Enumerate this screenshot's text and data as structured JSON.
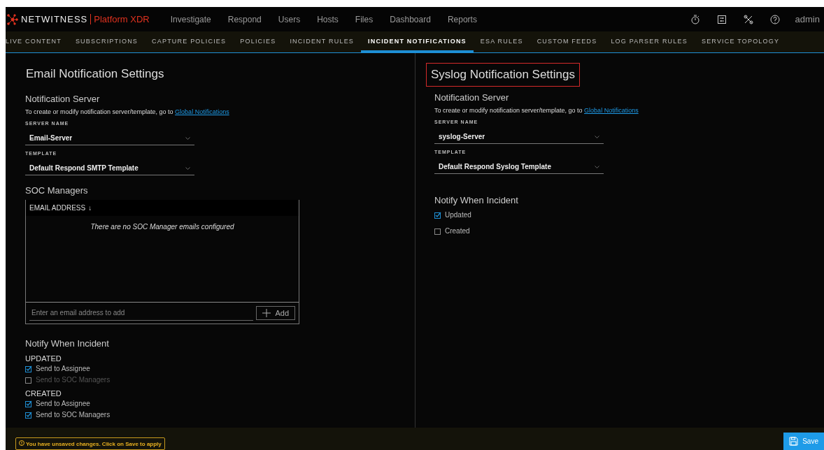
{
  "brand": {
    "name": "NETWITNESS",
    "product": "Platform XDR"
  },
  "nav": [
    "Investigate",
    "Respond",
    "Users",
    "Hosts",
    "Files",
    "Dashboard",
    "Reports"
  ],
  "user": "admin",
  "tabs": [
    {
      "label": "LIVE CONTENT",
      "selected": false
    },
    {
      "label": "SUBSCRIPTIONS",
      "selected": false
    },
    {
      "label": "CAPTURE POLICIES",
      "selected": false
    },
    {
      "label": "POLICIES",
      "selected": false
    },
    {
      "label": "INCIDENT RULES",
      "selected": false
    },
    {
      "label": "INCIDENT NOTIFICATIONS",
      "selected": true
    },
    {
      "label": "ESA RULES",
      "selected": false
    },
    {
      "label": "CUSTOM FEEDS",
      "selected": false
    },
    {
      "label": "LOG PARSER RULES",
      "selected": false
    },
    {
      "label": "SERVICE TOPOLOGY",
      "selected": false
    }
  ],
  "email": {
    "title": "Email Notification Settings",
    "server_heading": "Notification Server",
    "hint": "To create or modify notification server/template, go to ",
    "link": "Global Notifications",
    "server_label": "SERVER NAME",
    "server": "Email-Server",
    "template_label": "TEMPLATE",
    "template": "Default Respond SMTP Template",
    "soc_heading": "SOC Managers",
    "column": "EMAIL ADDRESS",
    "sort_icon": "↓",
    "empty": "There are no SOC Manager emails configured",
    "placeholder": "Enter an email address to add",
    "add": "Add",
    "notify_heading": "Notify When Incident",
    "groups": [
      {
        "label": "UPDATED",
        "options": [
          {
            "label": "Send to Assignee",
            "checked": true,
            "disabled": false
          },
          {
            "label": "Send to SOC Managers",
            "checked": false,
            "disabled": true
          }
        ]
      },
      {
        "label": "CREATED",
        "options": [
          {
            "label": "Send to Assignee",
            "checked": true,
            "disabled": false
          },
          {
            "label": "Send to SOC Managers",
            "checked": true,
            "disabled": false
          }
        ]
      }
    ]
  },
  "syslog": {
    "title": "Syslog Notification Settings",
    "server_heading": "Notification Server",
    "hint": "To create or modify notification server/template, go to ",
    "link": "Global Notifications",
    "server_label": "SERVER NAME",
    "server": "syslog-Server",
    "template_label": "TEMPLATE",
    "template": "Default Respond Syslog Template",
    "notify_heading": "Notify When Incident",
    "options": [
      {
        "label": "Updated",
        "checked": true
      },
      {
        "label": "Created",
        "checked": false
      }
    ]
  },
  "footer": {
    "warning": "You have unsaved changes. Click on Save to apply",
    "save": "Save"
  }
}
